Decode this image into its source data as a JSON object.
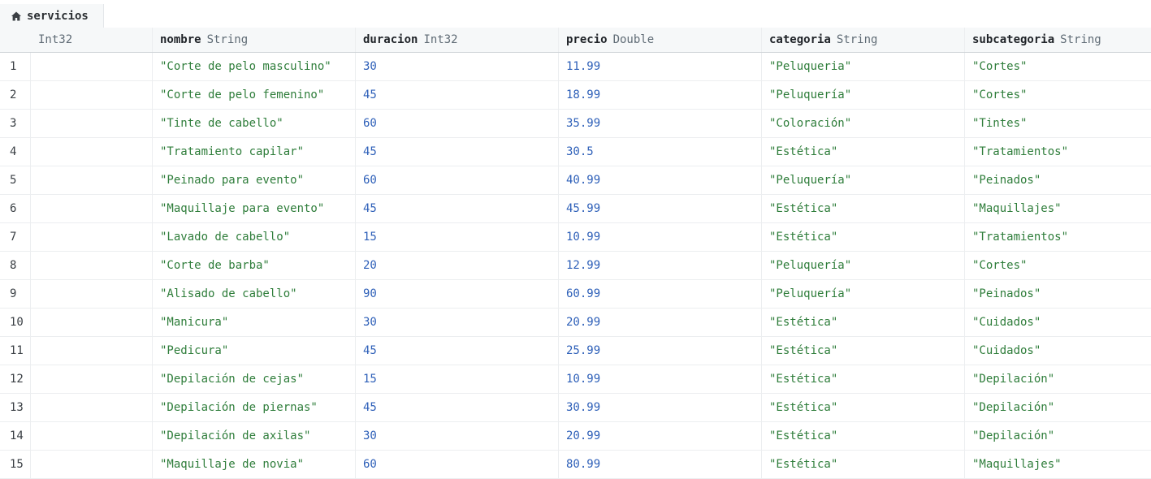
{
  "tab": {
    "label": "servicios"
  },
  "columns": [
    {
      "name": "",
      "type": "Int32"
    },
    {
      "name": "nombre",
      "type": "String"
    },
    {
      "name": "duracion",
      "type": "Int32"
    },
    {
      "name": "precio",
      "type": "Double"
    },
    {
      "name": "categoria",
      "type": "String"
    },
    {
      "name": "subcategoria",
      "type": "String"
    }
  ],
  "rows": [
    {
      "idx": "1",
      "id": "",
      "nombre": "\"Corte de pelo masculino\"",
      "duracion": "30",
      "precio": "11.99",
      "categoria": "\"Peluqueria\"",
      "subcategoria": "\"Cortes\""
    },
    {
      "idx": "2",
      "id": "",
      "nombre": "\"Corte de pelo femenino\"",
      "duracion": "45",
      "precio": "18.99",
      "categoria": "\"Peluquería\"",
      "subcategoria": "\"Cortes\""
    },
    {
      "idx": "3",
      "id": "",
      "nombre": "\"Tinte de cabello\"",
      "duracion": "60",
      "precio": "35.99",
      "categoria": "\"Coloración\"",
      "subcategoria": "\"Tintes\""
    },
    {
      "idx": "4",
      "id": "",
      "nombre": "\"Tratamiento capilar\"",
      "duracion": "45",
      "precio": "30.5",
      "categoria": "\"Estética\"",
      "subcategoria": "\"Tratamientos\""
    },
    {
      "idx": "5",
      "id": "",
      "nombre": "\"Peinado para evento\"",
      "duracion": "60",
      "precio": "40.99",
      "categoria": "\"Peluquería\"",
      "subcategoria": "\"Peinados\""
    },
    {
      "idx": "6",
      "id": "",
      "nombre": "\"Maquillaje para evento\"",
      "duracion": "45",
      "precio": "45.99",
      "categoria": "\"Estética\"",
      "subcategoria": "\"Maquillajes\""
    },
    {
      "idx": "7",
      "id": "",
      "nombre": "\"Lavado de cabello\"",
      "duracion": "15",
      "precio": "10.99",
      "categoria": "\"Estética\"",
      "subcategoria": "\"Tratamientos\""
    },
    {
      "idx": "8",
      "id": "",
      "nombre": "\"Corte de barba\"",
      "duracion": "20",
      "precio": "12.99",
      "categoria": "\"Peluquería\"",
      "subcategoria": "\"Cortes\""
    },
    {
      "idx": "9",
      "id": "",
      "nombre": "\"Alisado de cabello\"",
      "duracion": "90",
      "precio": "60.99",
      "categoria": "\"Peluquería\"",
      "subcategoria": "\"Peinados\""
    },
    {
      "idx": "10",
      "id": "",
      "nombre": "\"Manicura\"",
      "duracion": "30",
      "precio": "20.99",
      "categoria": "\"Estética\"",
      "subcategoria": "\"Cuidados\""
    },
    {
      "idx": "11",
      "id": "",
      "nombre": "\"Pedicura\"",
      "duracion": "45",
      "precio": "25.99",
      "categoria": "\"Estética\"",
      "subcategoria": "\"Cuidados\""
    },
    {
      "idx": "12",
      "id": "",
      "nombre": "\"Depilación de cejas\"",
      "duracion": "15",
      "precio": "10.99",
      "categoria": "\"Estética\"",
      "subcategoria": "\"Depilación\""
    },
    {
      "idx": "13",
      "id": "",
      "nombre": "\"Depilación de piernas\"",
      "duracion": "45",
      "precio": "30.99",
      "categoria": "\"Estética\"",
      "subcategoria": "\"Depilación\""
    },
    {
      "idx": "14",
      "id": "",
      "nombre": "\"Depilación de axilas\"",
      "duracion": "30",
      "precio": "20.99",
      "categoria": "\"Estética\"",
      "subcategoria": "\"Depilación\""
    },
    {
      "idx": "15",
      "id": "",
      "nombre": "\"Maquillaje de novia\"",
      "duracion": "60",
      "precio": "80.99",
      "categoria": "\"Estética\"",
      "subcategoria": "\"Maquillajes\""
    }
  ],
  "colors": {
    "string_value": "#2e7d3a",
    "number_value": "#2d5fb8",
    "header_bg": "#f6f8f9"
  },
  "icons": {
    "tab": "home-icon"
  }
}
